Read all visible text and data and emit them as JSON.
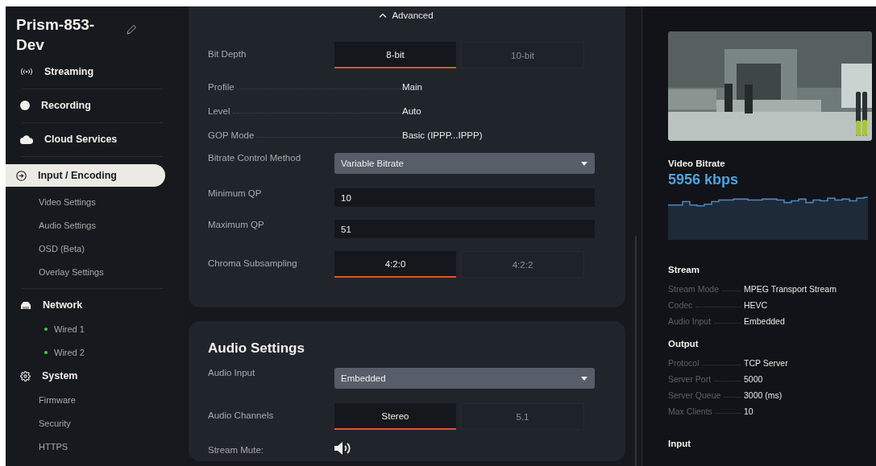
{
  "sidebar": {
    "title": "Prism-853-Dev",
    "items": [
      {
        "label": "Streaming",
        "selected": false
      },
      {
        "label": "Recording",
        "selected": false
      },
      {
        "label": "Cloud Services",
        "selected": false
      },
      {
        "label": "Input / Encoding",
        "selected": true,
        "children": [
          {
            "label": "Video Settings"
          },
          {
            "label": "Audio Settings"
          },
          {
            "label": "OSD (Beta)"
          },
          {
            "label": "Overlay Settings"
          }
        ]
      },
      {
        "label": "Network",
        "selected": false,
        "children": [
          {
            "label": "Wired 1",
            "color": "#3fd23a"
          },
          {
            "label": "Wired 2",
            "color": "#3fd23a"
          }
        ]
      },
      {
        "label": "System",
        "selected": false,
        "children": [
          {
            "label": "Firmware"
          },
          {
            "label": "Security"
          },
          {
            "label": "HTTPS"
          }
        ]
      }
    ]
  },
  "advanced": {
    "label": "Advanced",
    "expanded": true
  },
  "video_fields": [
    {
      "kind": "segmented",
      "label": "Bit Depth",
      "options": [
        {
          "label": "8-bit",
          "selected": true
        },
        {
          "label": "10-bit",
          "selected": false
        }
      ]
    },
    {
      "kind": "info",
      "label": "Profile",
      "value": "Main"
    },
    {
      "kind": "info",
      "label": "Level",
      "value": "Auto"
    },
    {
      "kind": "info",
      "label": "GOP Mode",
      "value": "Basic (IPPP...IPPP)"
    },
    {
      "kind": "select",
      "label": "Bitrate Control Method",
      "value": "Variable Bitrate"
    },
    {
      "kind": "input",
      "label": "Minimum QP",
      "value": "10"
    },
    {
      "kind": "input",
      "label": "Maximum QP",
      "value": "51"
    },
    {
      "kind": "segmented",
      "label": "Chroma Subsampling",
      "options": [
        {
          "label": "4:2:0",
          "selected": true
        },
        {
          "label": "4:2:2",
          "selected": false
        }
      ]
    }
  ],
  "audio": {
    "title": "Audio Settings",
    "fields": [
      {
        "kind": "select",
        "label": "Audio Input",
        "value": "Embedded"
      },
      {
        "kind": "segmented",
        "label": "Audio Channels",
        "options": [
          {
            "label": "Stereo",
            "selected": true
          },
          {
            "label": "5.1",
            "selected": false
          }
        ]
      },
      {
        "kind": "mute",
        "label": "Stream Mute:",
        "muted": false
      }
    ]
  },
  "preview": {
    "meters": [
      {
        "level": 0.35
      },
      {
        "level": 0.37
      }
    ]
  },
  "video_bitrate": {
    "label": "Video Bitrate",
    "value": "5956 kbps"
  },
  "info_sections": [
    {
      "title": "Stream",
      "rows": [
        {
          "label": "Stream Mode",
          "value": "MPEG Transport Stream"
        },
        {
          "label": "Codec",
          "value": "HEVC"
        },
        {
          "label": "Audio Input",
          "value": "Embedded"
        }
      ]
    },
    {
      "title": "Output",
      "rows": [
        {
          "label": "Protocol",
          "value": "TCP Server"
        },
        {
          "label": "Server Port",
          "value": "5000"
        },
        {
          "label": "Server Queue",
          "value": "3000 (ms)"
        },
        {
          "label": "Max Clients",
          "value": "10"
        }
      ]
    },
    {
      "title": "Input"
    }
  ]
}
